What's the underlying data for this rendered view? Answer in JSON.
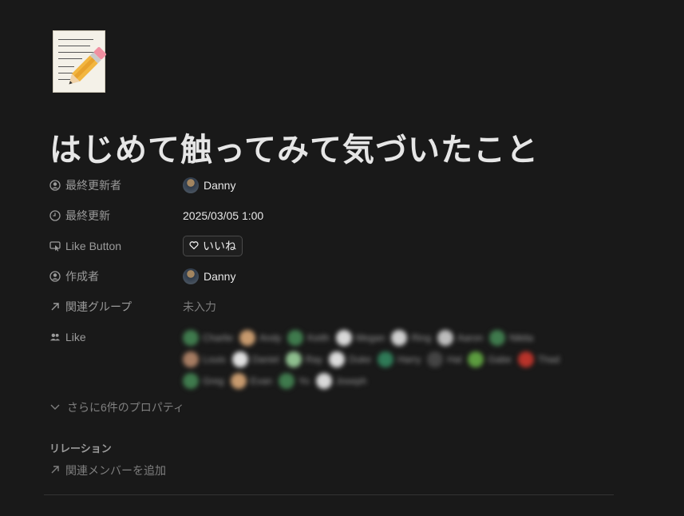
{
  "page": {
    "title": "はじめて触ってみて気づいたこと",
    "icon": "memo-pencil-icon"
  },
  "properties": {
    "last_edited_by": {
      "label": "最終更新者",
      "icon": "person-circle-icon",
      "value": "Danny"
    },
    "last_edited_time": {
      "label": "最終更新",
      "icon": "clock-icon",
      "value": "2025/03/05 1:00"
    },
    "like_button": {
      "label": "Like Button",
      "icon": "cursor-button-icon",
      "value": "いいね",
      "value_icon": "heart-icon"
    },
    "created_by": {
      "label": "作成者",
      "icon": "person-circle-icon",
      "value": "Danny"
    },
    "related_group": {
      "label": "関連グループ",
      "icon": "arrow-up-right-icon",
      "value": "未入力"
    },
    "like": {
      "label": "Like",
      "icon": "people-icon",
      "lines": [
        [
          "Charlie",
          "Andy",
          "Keith",
          "Megan",
          "Ring",
          "Aaron",
          "Nikita"
        ],
        [
          "Louis",
          "Daniel",
          "Ray",
          "Duke",
          "Harry",
          "Hal",
          "Gabe",
          "Thad"
        ],
        [
          "Greg",
          "Evan",
          "Yo",
          "Joseph"
        ]
      ],
      "colors": [
        "#3f7a4d",
        "#c79a6e",
        "#3f7a4d",
        "#d9d9d9",
        "#cfcfcf",
        "#bdbdbd",
        "#3f7a4d",
        "#a67c62",
        "#e0e0e0",
        "#8fbf8f",
        "#dcdcdc",
        "#2f7a57",
        "#444444",
        "#5c9c3f",
        "#b8332a"
      ]
    }
  },
  "more_properties": {
    "label": "さらに6件のプロパティ",
    "icon": "chevron-down-icon"
  },
  "relations": {
    "title": "リレーション",
    "add_label": "関連メンバーを追加",
    "add_icon": "arrow-up-right-icon"
  }
}
